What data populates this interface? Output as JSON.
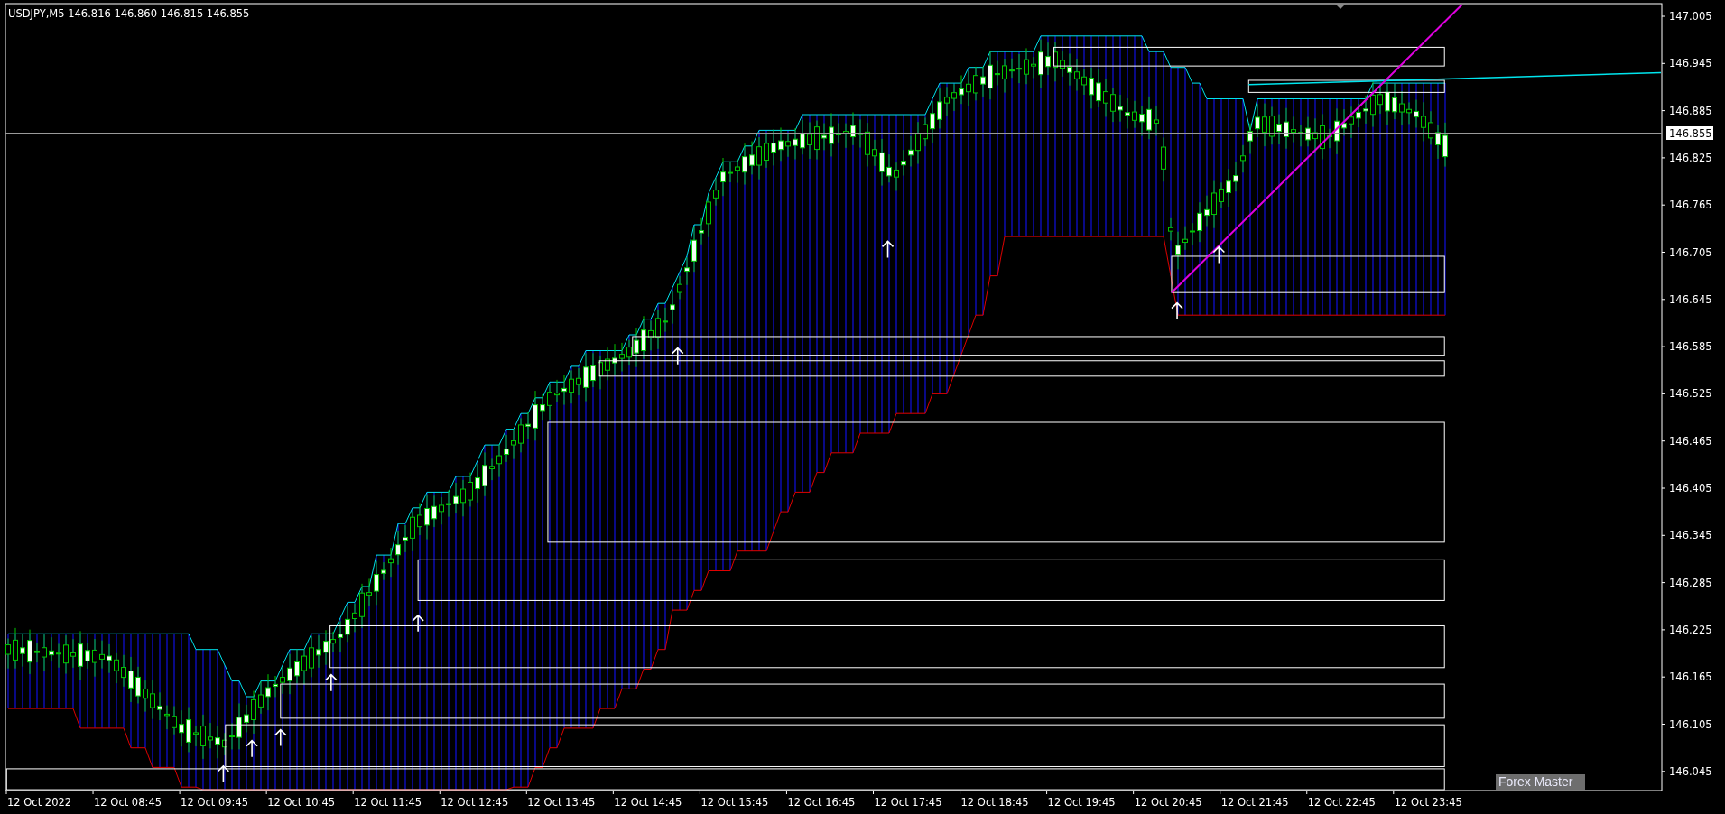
{
  "chart": {
    "header": "USDJPY,M5  146.816 146.860 146.815 146.855",
    "price_axis": [
      "147.005",
      "146.945",
      "146.885",
      "146.825",
      "146.765",
      "146.705",
      "146.645",
      "146.585",
      "146.525",
      "146.465",
      "146.405",
      "146.345",
      "146.285",
      "146.225",
      "146.165",
      "146.105",
      "146.045"
    ],
    "current_price": "146.855",
    "time_axis": [
      "12 Oct 2022",
      "12 Oct 08:45",
      "12 Oct 09:45",
      "12 Oct 10:45",
      "12 Oct 11:45",
      "12 Oct 12:45",
      "12 Oct 13:45",
      "12 Oct 14:45",
      "12 Oct 15:45",
      "12 Oct 16:45",
      "12 Oct 17:45",
      "12 Oct 18:45",
      "12 Oct 19:45",
      "12 Oct 20:45",
      "12 Oct 21:45",
      "12 Oct 22:45",
      "12 Oct 23:45"
    ],
    "label": "Forex Master"
  }
}
